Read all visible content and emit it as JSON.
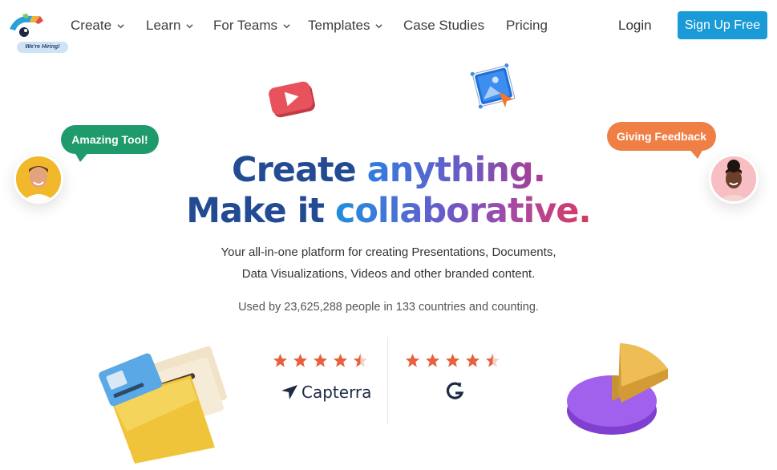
{
  "nav": {
    "hiring_badge": "We're Hiring!",
    "items": [
      {
        "label": "Create",
        "has_dropdown": true
      },
      {
        "label": "Learn",
        "has_dropdown": true
      },
      {
        "label": "For Teams",
        "has_dropdown": true
      },
      {
        "label": "Templates",
        "has_dropdown": true
      },
      {
        "label": "Case Studies",
        "has_dropdown": false
      },
      {
        "label": "Pricing",
        "has_dropdown": false
      }
    ],
    "login_label": "Login",
    "signup_label": "Sign Up Free",
    "signup_color": "#1a9bd7"
  },
  "bubbles": {
    "left": "Amazing Tool!",
    "right": "Giving Feedback",
    "left_color": "#1f9a6a",
    "right_color": "#ef7f45"
  },
  "hero": {
    "line1_a": "Create",
    "line1_b": "anything.",
    "line2_a": "Make it",
    "line2_b": "collaborative.",
    "sub1": "Your all-in-one platform for creating Presentations, Documents,",
    "sub2": "Data Visualizations, Videos and other branded content.",
    "used_by": "Used by 23,625,288 people in 133 countries and counting."
  },
  "ratings": [
    {
      "source": "Capterra",
      "stars": 4.5,
      "logo_text": "Capterra"
    },
    {
      "source": "G2",
      "stars": 4.5
    }
  ],
  "icons": [
    "logo-icon",
    "video-play-icon",
    "image-edit-icon",
    "star-icon",
    "capterra-icon",
    "g2-icon",
    "folder-illustration",
    "pie-chart-illustration",
    "chevron-down-icon"
  ]
}
